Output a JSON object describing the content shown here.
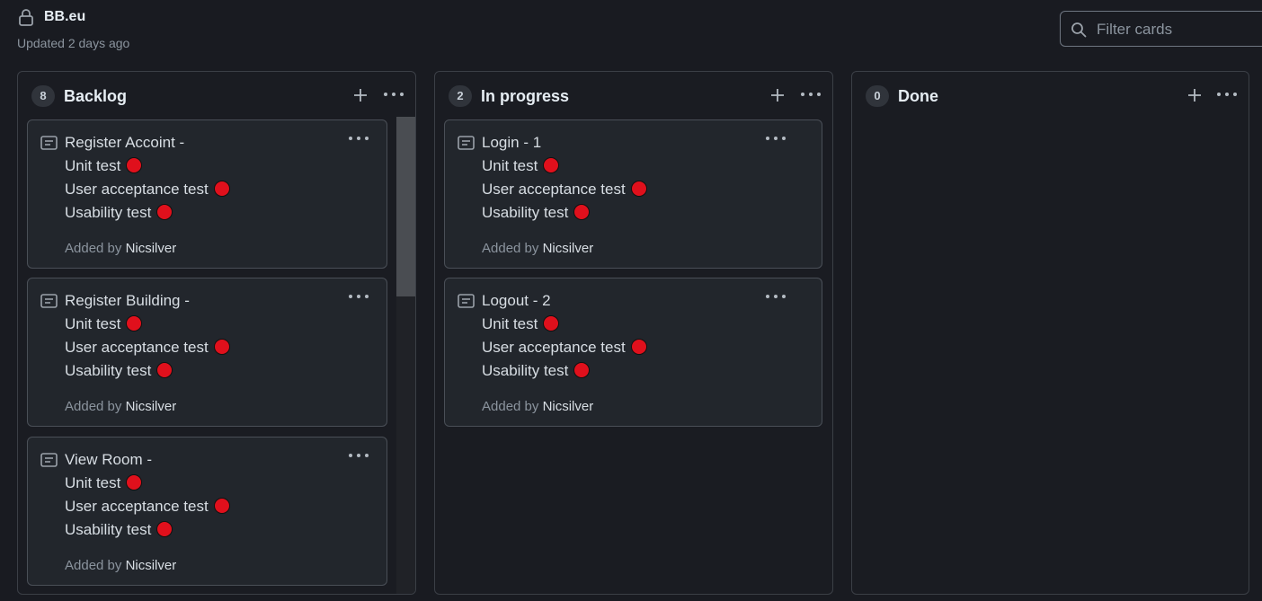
{
  "header": {
    "title": "BB.eu",
    "lock_icon": "lock-icon",
    "updated": "Updated 2 days ago",
    "filter_placeholder": "Filter cards"
  },
  "colors": {
    "background": "#191b21",
    "status_dot": "#e0101c"
  },
  "columns": [
    {
      "count": "8",
      "name": "Backlog",
      "cards": [
        {
          "title": "Register Accoint -",
          "tests": [
            "Unit test",
            "User acceptance test",
            "Usability test"
          ],
          "added_prefix": "Added by",
          "author": "Nicsilver"
        },
        {
          "title": "Register Building -",
          "tests": [
            "Unit test",
            "User acceptance test",
            "Usability test"
          ],
          "added_prefix": "Added by",
          "author": "Nicsilver"
        },
        {
          "title": "View Room -",
          "tests": [
            "Unit test",
            "User acceptance test",
            "Usability test"
          ],
          "added_prefix": "Added by",
          "author": "Nicsilver"
        }
      ]
    },
    {
      "count": "2",
      "name": "In progress",
      "cards": [
        {
          "title": "Login - 1",
          "tests": [
            "Unit test",
            "User acceptance test",
            "Usability test"
          ],
          "added_prefix": "Added by",
          "author": "Nicsilver"
        },
        {
          "title": "Logout - 2",
          "tests": [
            "Unit test",
            "User acceptance test",
            "Usability test"
          ],
          "added_prefix": "Added by",
          "author": "Nicsilver"
        }
      ]
    },
    {
      "count": "0",
      "name": "Done",
      "cards": []
    }
  ]
}
